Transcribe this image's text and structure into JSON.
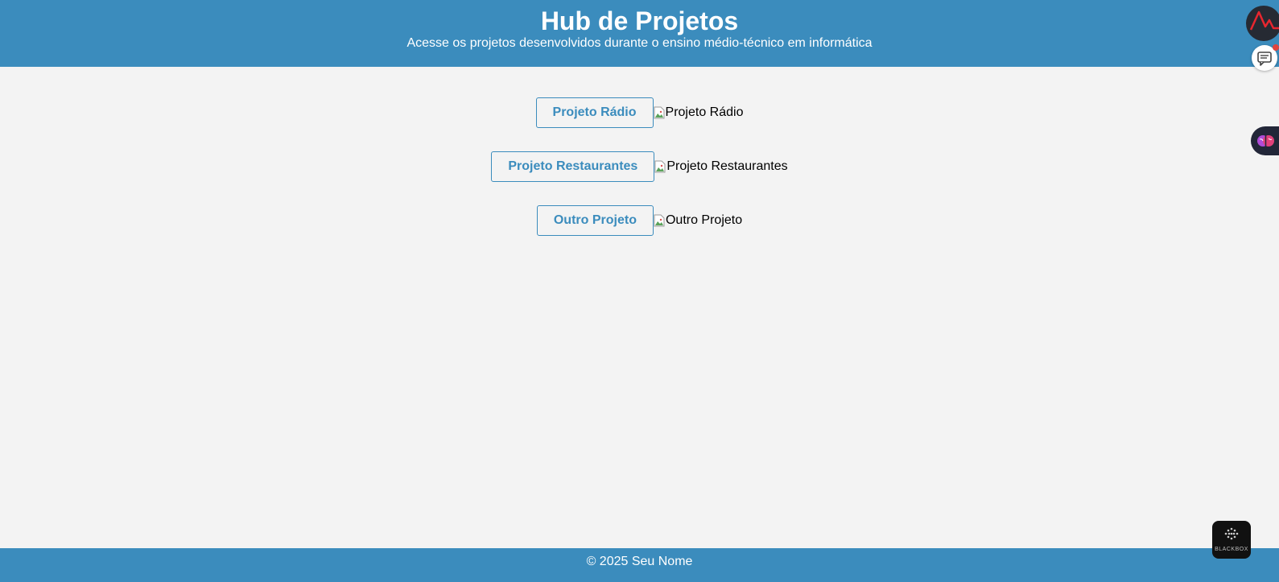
{
  "header": {
    "title": "Hub de Projetos",
    "subtitle": "Acesse os projetos desenvolvidos durante o ensino médio-técnico em informática"
  },
  "projects": [
    {
      "button_label": "Projeto Rádio",
      "image_alt": "Projeto Rádio"
    },
    {
      "button_label": "Projeto Restaurantes",
      "image_alt": "Projeto Restaurantes"
    },
    {
      "button_label": "Outro Projeto",
      "image_alt": "Outro Projeto"
    }
  ],
  "footer": {
    "text": "© 2025 Seu Nome"
  },
  "extensions": {
    "blackbox_label": "BLACKBOX"
  },
  "colors": {
    "header_bg": "#3b8cbd",
    "page_bg": "#f3f3f3",
    "button_text": "#3b8cbd"
  }
}
